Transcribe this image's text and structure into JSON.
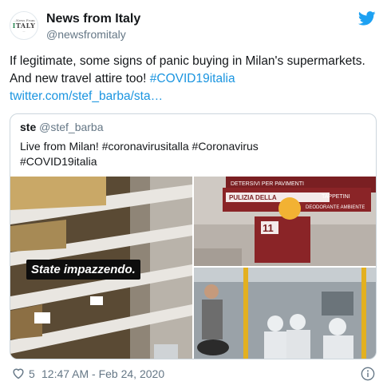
{
  "tweet": {
    "author": {
      "name": "News from Italy",
      "handle": "@newsfromitaly"
    },
    "avatar": {
      "line1": "...News From",
      "main_i": "I",
      "main_rest": "TALY",
      "line3": "..."
    },
    "text_part1": "If legitimate, some signs of panic buying in Milan's supermarkets. And new travel attire too!",
    "hashtag": "#COVID19italia",
    "link": "twitter.com/stef_barba/sta…",
    "likes": "5",
    "timestamp": "12:47 AM - Feb 24, 2020"
  },
  "quoted": {
    "name": "ste",
    "handle": "@stef_barba",
    "line1": "Live from Milan! #coronavirusitalla #Coronavirus",
    "line2": "#COVID19italia",
    "media_caption": "State impazzendo.",
    "store_sign": {
      "top": "DETERSIVI PER PAVIMENTI",
      "right_top": "TAPPETINI",
      "middle": "PULIZIA DELLA",
      "right_middle": "DEODORANTE AMBIENTE",
      "aisle": "11"
    }
  },
  "colors": {
    "link": "#1b95e0",
    "bird": "#1da1f2",
    "muted": "#657786",
    "border": "#ccd6dd"
  },
  "icons": [
    "twitter-bird-icon",
    "heart-icon",
    "info-icon"
  ]
}
